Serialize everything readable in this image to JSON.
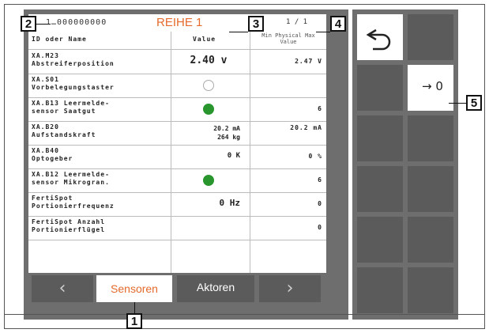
{
  "header": {
    "serial": "1…000000000",
    "title": "REIHE 1",
    "page": "1 / 1"
  },
  "columns": {
    "name": "ID oder Name",
    "value": "Value",
    "limits": "Min Physical  Max Value"
  },
  "rows": [
    {
      "id": "XA.M23",
      "name": "Abstreiferposition",
      "value": "2.40 v",
      "indicator": null,
      "max": "2.47 V"
    },
    {
      "id": "XA.S01",
      "name": "Vorbelegungstaster",
      "value": "",
      "indicator": "empty",
      "max": ""
    },
    {
      "id": "XA.B13 Leermelde-",
      "name": "sensor Saatgut",
      "value": "",
      "indicator": "green",
      "max": "6"
    },
    {
      "id": "XA.B20",
      "name": "Aufstandskraft",
      "value": "20.2 mA\n264 kg",
      "indicator": null,
      "max": "20.2 mA"
    },
    {
      "id": "XA.B40",
      "name": "Optogeber",
      "value": "0 K",
      "indicator": null,
      "max": "0 %"
    },
    {
      "id": "XA.B12 Leermelde-",
      "name": "sensor Mikrogran.",
      "value": "",
      "indicator": "green",
      "max": "6"
    },
    {
      "id": "FertiSpot",
      "name": "Portionierfrequenz",
      "value": "0 Hz",
      "indicator": null,
      "max": "0"
    },
    {
      "id": "FertiSpot Anzahl",
      "name": "Portionierflügel",
      "value": "",
      "indicator": null,
      "max": "0"
    }
  ],
  "nav": {
    "prev_icon": "chevron-left-icon",
    "tab_sensors": "Sensoren",
    "tab_actuators": "Aktoren",
    "next_icon": "chevron-right-icon"
  },
  "softkeys": {
    "back_icon": "undo-icon",
    "zero_label": "→ 0"
  },
  "callouts": [
    "1",
    "2",
    "3",
    "4",
    "5"
  ],
  "colors": {
    "accent": "#e56a2c",
    "indicator_on": "#28962c",
    "panel": "#6e6e6e",
    "button": "#5b5b5b"
  }
}
